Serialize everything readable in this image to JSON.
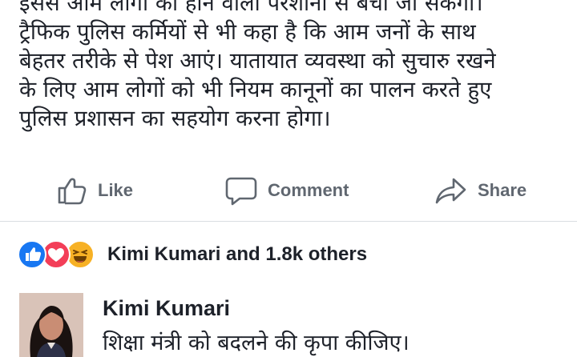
{
  "post": {
    "lines": [
      "इससे आम लोगों को होने वाली परेशानी से बचा जा सकेगा।",
      "ट्रैफिक पुलिस कर्मियों से भी कहा है कि आम जनों के साथ",
      "बेहतर तरीके से पेश आएं। यातायात व्यवस्था को सुचारु रखने",
      "के लिए आम लोगों को भी नियम कानूनों का पालन करते हुए",
      "पुलिस प्रशासन का सहयोग करना होगा।"
    ]
  },
  "actions": {
    "like_label": "Like",
    "comment_label": "Comment",
    "share_label": "Share",
    "icon_color": "#606770"
  },
  "reactions": {
    "icons": [
      "like-icon",
      "love-icon",
      "haha-icon"
    ],
    "summary": "Kimi Kumari and 1.8k others"
  },
  "comment": {
    "author": "Kimi Kumari",
    "text": "शिक्षा मंत्री को बदलने की कृपा कीजिए।"
  },
  "colors": {
    "like_blue": "#1877f2",
    "love_red": "#f33e58",
    "haha_yellow": "#f7b125"
  }
}
